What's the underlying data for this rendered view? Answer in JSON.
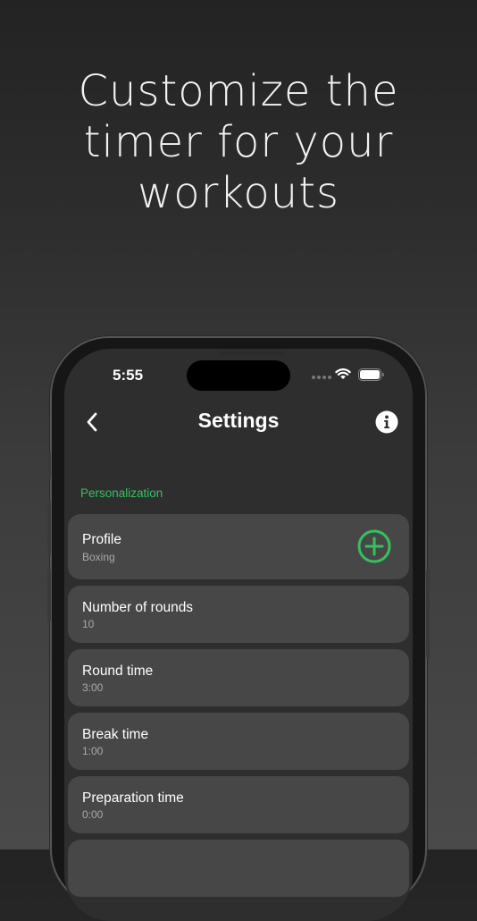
{
  "headline": {
    "lines": [
      "Customize the",
      "timer for your",
      "workouts"
    ]
  },
  "status_bar": {
    "time": "5:55"
  },
  "nav": {
    "title": "Settings",
    "back_icon": "chevron-left-icon",
    "info_icon": "info-icon"
  },
  "section": {
    "header": "Personalization"
  },
  "rows": [
    {
      "title": "Profile",
      "value": "Boxing",
      "action_icon": "plus-circle-icon"
    },
    {
      "title": "Number of rounds",
      "value": "10"
    },
    {
      "title": "Round time",
      "value": "3:00"
    },
    {
      "title": "Break time",
      "value": "1:00"
    },
    {
      "title": "Preparation time",
      "value": "0:00"
    }
  ],
  "colors": {
    "accent": "#35c15e",
    "row_background": "#474747",
    "screen_background": "#2e2e2e"
  }
}
